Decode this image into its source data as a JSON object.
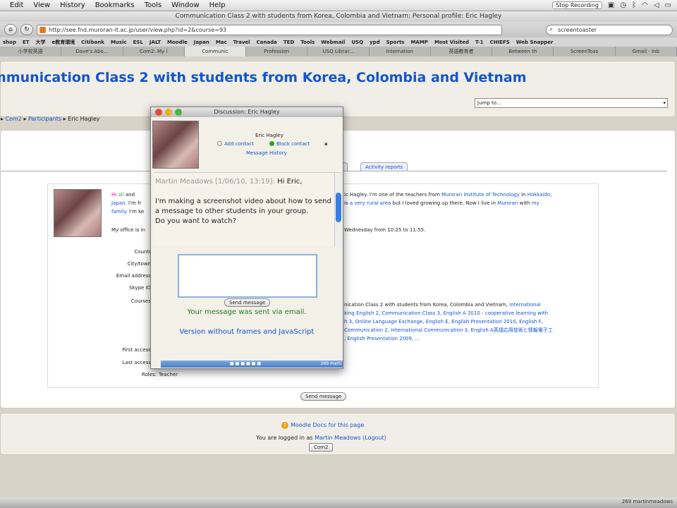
{
  "menubar": {
    "items": [
      "Edit",
      "View",
      "History",
      "Bookmarks",
      "Tools",
      "Window",
      "Help"
    ],
    "recording": "Stop Recording"
  },
  "window_title": "Communication Class 2 with students from Korea, Colombia and Vietnam: Personal profile: Eric Hagley",
  "toolbar": {
    "url": "http://see.fnd.muroran-it.ac.jp/user/view.php?id=2&course=93",
    "search": "screentoaster"
  },
  "bookmarks": [
    "shop",
    "ET",
    "大学",
    "e教育環境",
    "Citibank",
    "Music",
    "ESL",
    "JALT",
    "Moodle",
    "Japan",
    "Mac",
    "Travel",
    "Canada",
    "TED",
    "Tools",
    "Webmail",
    "USQ",
    "ypd",
    "Sports",
    "MAMP",
    "Most Visited",
    "T-1",
    "CHIEFS",
    "Web Snapper"
  ],
  "tabs": [
    "小学校英語",
    "Dave's Abo...",
    "Com2: My i",
    "Communic",
    "Profession",
    "USQ Librar...",
    "Internation",
    "英語教育者",
    "Between th",
    "ScreenToas",
    "Gmail - Inb"
  ],
  "header": {
    "course_title": "mmunication Class 2 with students from Korea, Colombia and Vietnam",
    "jump_to": "Jump to..."
  },
  "breadcrumb": {
    "course": "Com2",
    "participants": "Participants",
    "current": "Eric Hagley"
  },
  "profile": {
    "tab_activity": "Activity reports",
    "tab_partial": "ile",
    "intro_l1a": "Hi",
    "intro_l1b": "all",
    "intro_l1c": "and",
    "intro_r1": "ic Hagley. I'm one of the teachers from",
    "intro_r1_link1": "Muroran Institute of Technology",
    "intro_r1_mid": "in",
    "intro_r1_link2": "Hokkaido,",
    "intro_l2a": "Japan.",
    "intro_l2b": "I'm fr",
    "intro_r2a": "is",
    "intro_r2_link": "a very rural area",
    "intro_r2b": "but I loved growing up there. Now I live in",
    "intro_r2_link2": "Muroran",
    "intro_r2c": "with",
    "intro_r2_link3": "my",
    "intro_l3a": "family.",
    "intro_l3b": "I'm ke",
    "office_left": "My office is in",
    "office_right": "Wednesday from 10:25 to 11:55.",
    "labels": {
      "country": "Countr",
      "city": "City/town",
      "email": "Email address",
      "skype": "Skype ID",
      "courses": "Courses",
      "first_access": "First access",
      "last_access": "Last access",
      "roles": "Roles:"
    },
    "roles_value": "Teacher",
    "courses_text": [
      {
        "t": "nication Class 2 with students from Korea, Colombia and Vietnam, ",
        "link": "International"
      },
      {
        "t": "",
        "link": "king English 2, Communication Class 3, English A 2010 - cooperative learning with"
      },
      {
        "t": "",
        "link": "h 3, Online Language Exchange, English E, English Presentation 2010, English F,"
      },
      {
        "t": "",
        "link": "Communication 2, International Communication 3, English A英語応用技術と情報電子工"
      },
      {
        "t": "",
        "link": ", English Presentation 2009, ..."
      }
    ],
    "send_message": "Send message"
  },
  "popup": {
    "title": "Discussion: Eric Hagley",
    "name": "Eric Hagley",
    "add_contact": "Add contact",
    "block_contact": "Block contact",
    "history": "Message History",
    "msg_sender": "Martin Meadows [1/06/10, 13:19]:",
    "msg_greeting": "Hi Eric,",
    "msg_body": "I'm making a screenshot video about how to send a message to other students in your group.",
    "msg_question": "Do you want to watch?",
    "send_label": "Send message",
    "sent_notice": "Your message was sent via email.",
    "noframes_link": "Version without frames and JavaScript",
    "statusbar_text": "269 marti"
  },
  "footer": {
    "docs": "Moodle Docs for this page",
    "logged_prefix": "You are logged in as",
    "user": "Martin Meadows",
    "logout": "(Logout)",
    "course_button": "Com2"
  },
  "dock": {
    "right_text": "269 martinmeadows"
  },
  "colors": {
    "link": "#1155cc",
    "title": "#1155cc",
    "success": "#227722"
  }
}
